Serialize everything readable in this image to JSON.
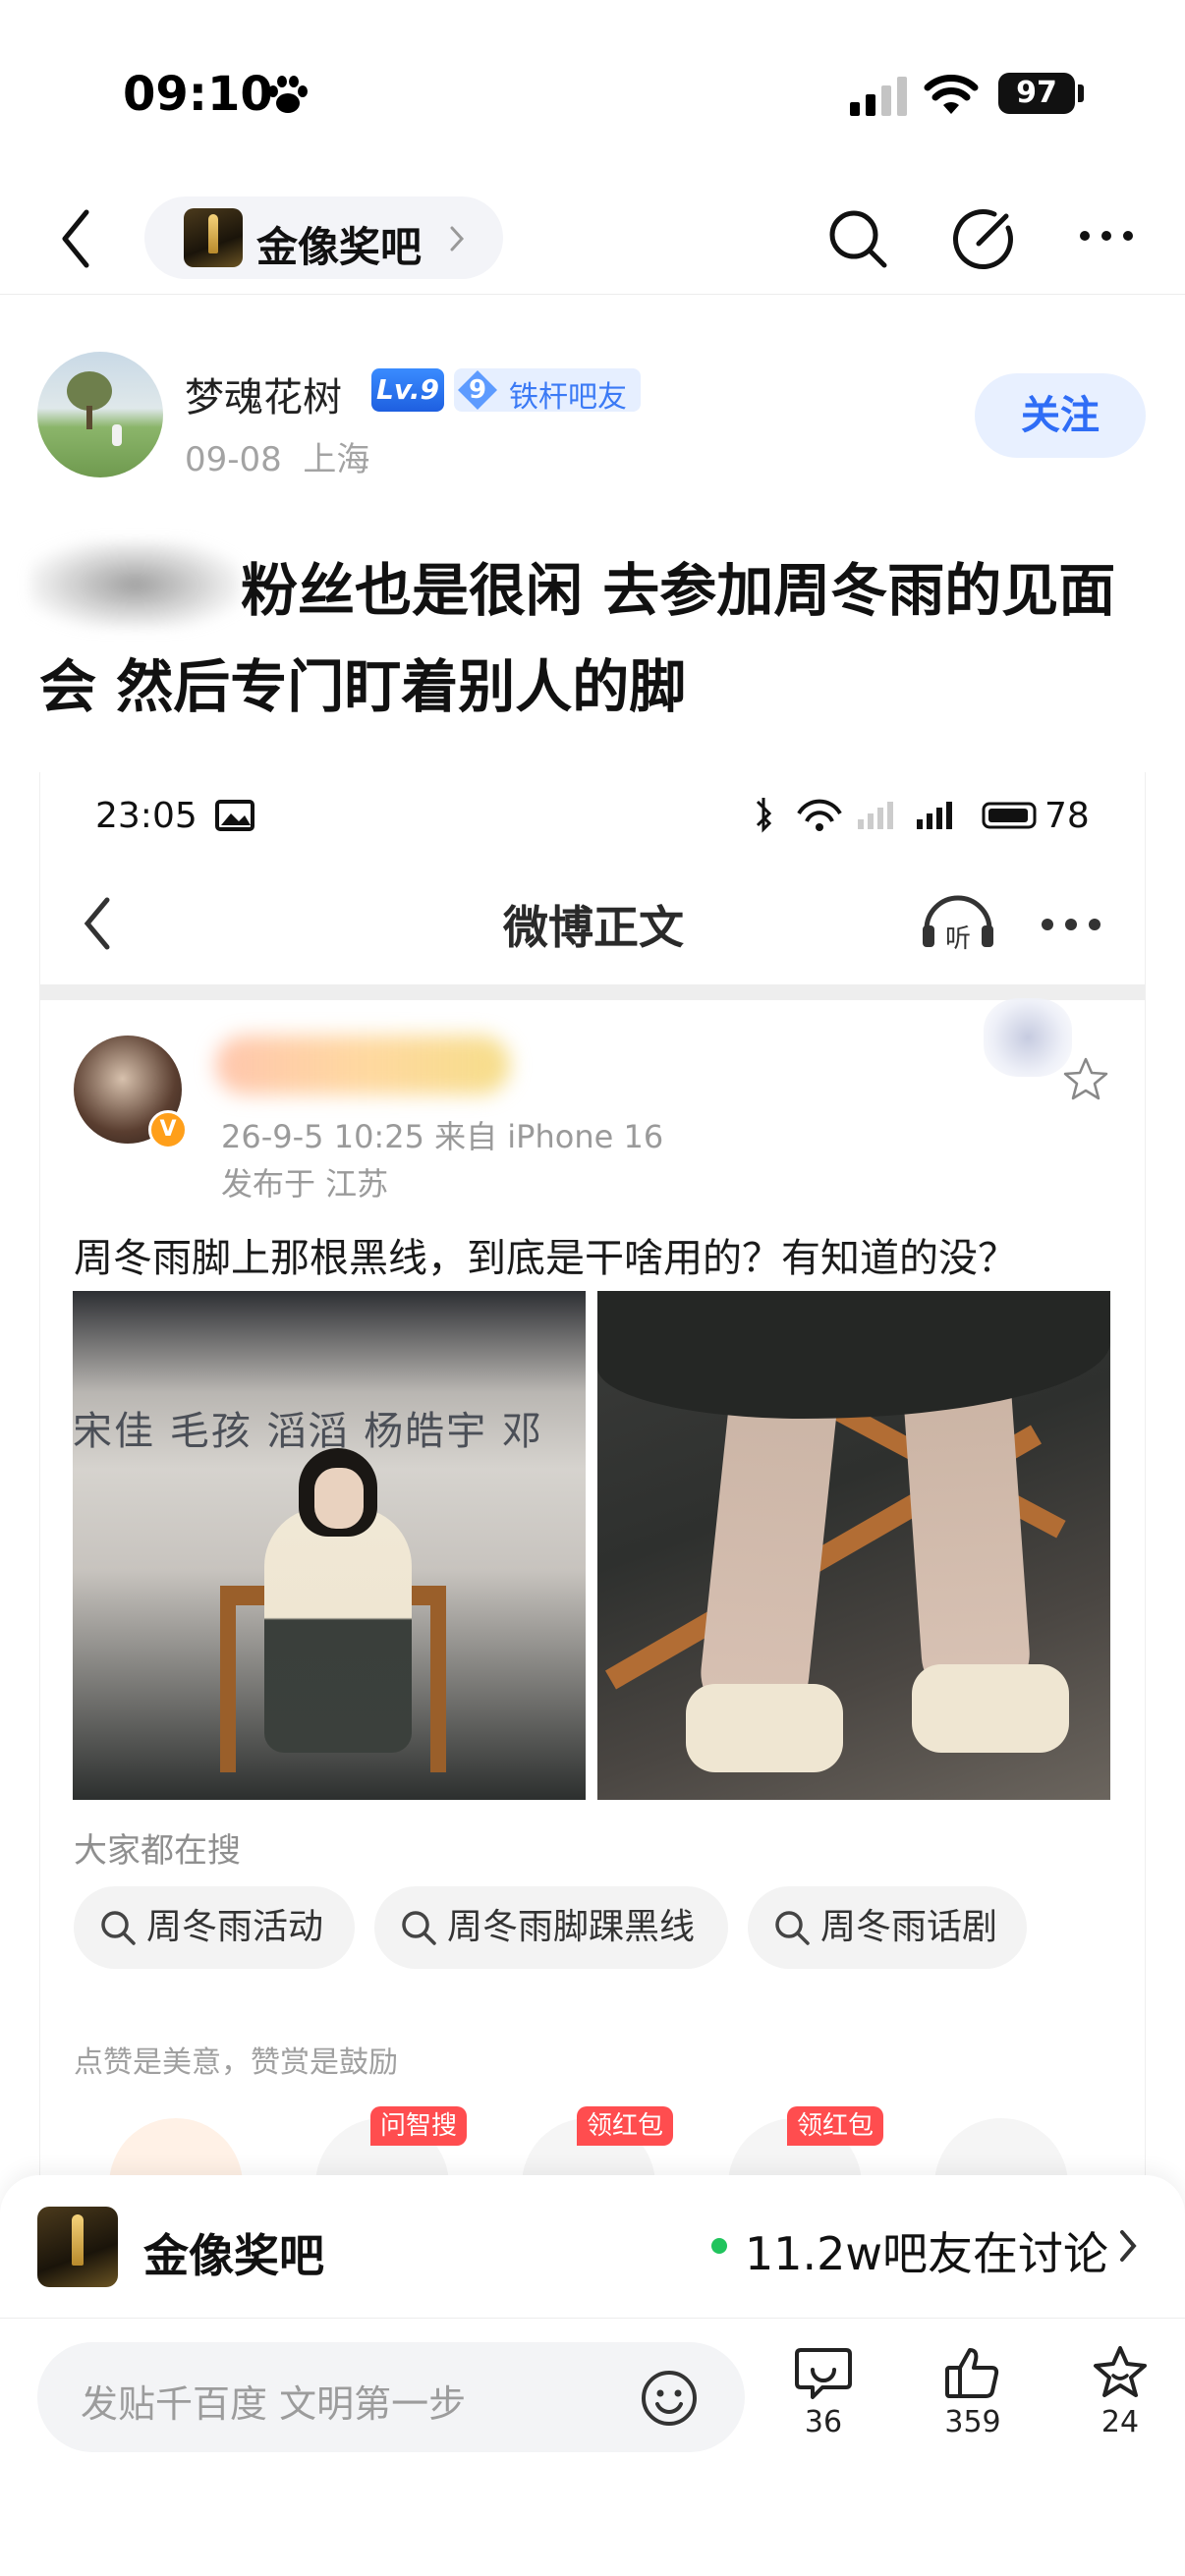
{
  "status_bar": {
    "time": "09:10",
    "battery": "97"
  },
  "nav": {
    "forum_name": "金像奖吧"
  },
  "post": {
    "author": "梦魂花树",
    "level": "Lv.9",
    "member_level": "9",
    "member_title": "铁杆吧友",
    "date": "09-08",
    "location": "上海",
    "follow_label": "关注",
    "title": "粉丝也是很闲 去参加周冬雨的见面会 然后专门盯着别人的脚"
  },
  "embedded": {
    "time": "23:05",
    "battery": "78",
    "page_title": "微博正文",
    "listen_label": "听",
    "meta": "26-9-5 10:25  来自 iPhone 16",
    "location": "发布于 江苏",
    "text": "周冬雨脚上那根黑线，到底是干啥用的？有知道的没？",
    "photo_banner": "宋佳 毛孩 滔滔 杨皓宇 邓",
    "search_heading": "大家都在搜",
    "search_chips": [
      "周冬雨活动",
      "周冬雨脚踝黑线",
      "周冬雨话剧"
    ],
    "reward_note": "点赞是美意，赞赏是鼓励",
    "reward_tags": [
      "问智搜",
      "领红包",
      "领红包"
    ]
  },
  "banner": {
    "forum_name": "金像奖吧",
    "online_text": "11.2w吧友在讨论"
  },
  "bottom_bar": {
    "input_placeholder": "发贴千百度 文明第一步",
    "comments": "36",
    "likes": "359",
    "favorites": "24"
  },
  "colors": {
    "accent": "#2f6df6",
    "follow_bg": "#e8f0ff",
    "online_dot": "#21c45d",
    "reward_tag": "#ff4d4f"
  },
  "icons": [
    "paw-icon",
    "signal-icon",
    "wifi-icon",
    "back-icon",
    "chevron-right-icon",
    "search-icon",
    "edit-icon",
    "more-icon",
    "star-icon",
    "listen-icon",
    "emoji-icon",
    "comment-icon",
    "like-icon",
    "favorite-icon"
  ]
}
